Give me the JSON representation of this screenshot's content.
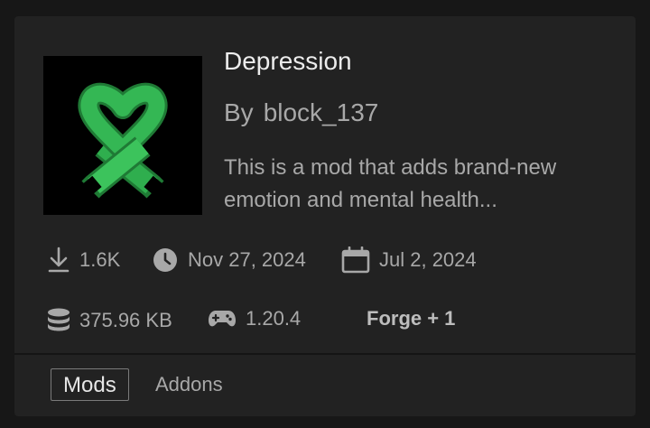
{
  "mod": {
    "title": "Depression",
    "author_prefix": "By",
    "author": "block_137",
    "description": "This is a mod that adds brand-new emotion and mental health...",
    "thumbnail_icon": "green-awareness-ribbon"
  },
  "stats": {
    "downloads": "1.6K",
    "updated": "Nov 27, 2024",
    "created": "Jul 2, 2024",
    "file_size": "375.96 KB",
    "game_version": "1.20.4",
    "loaders": "Forge + 1"
  },
  "tags": [
    "Mods",
    "Addons"
  ],
  "colors": {
    "background": "#171717",
    "card": "#222222",
    "title_text": "#ececec",
    "secondary_text": "#a8a8a8",
    "ribbon_green": "#2fae4e"
  }
}
